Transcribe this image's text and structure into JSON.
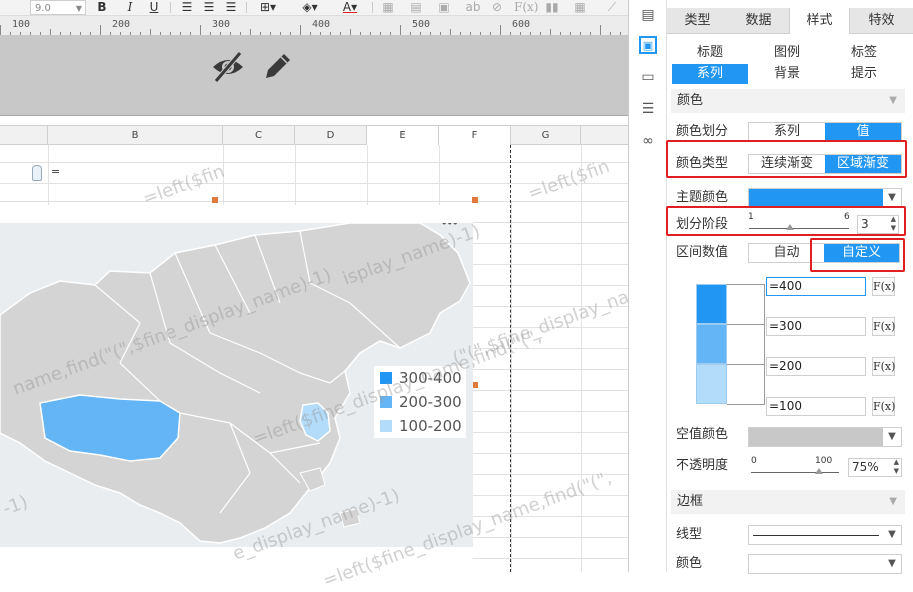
{
  "toolbar": {
    "font_size": "9.0",
    "bold": "B",
    "italic": "I",
    "underline": "U",
    "font_color": "A",
    "text_ab": "ab",
    "formula": "F(x)"
  },
  "ruler": {
    "labels": [
      "100",
      "200",
      "300",
      "400",
      "500",
      "600"
    ]
  },
  "sheet": {
    "columns": [
      "B",
      "C",
      "D",
      "E",
      "F",
      "G"
    ],
    "cell_formula": "=",
    "watermark_texts": [
      "=left($fin",
      "=left($fin",
      "isplay_name)-1)",
      "name,find(\"(\",$fine_display_name)-1)",
      "=left($fine_display_name,find(\"(\",",
      "e_display_name)-1)",
      "-1)",
      "(\"(\",$fine_display_name)-1)",
      "=left($fine_display_name,find(\"(\","
    ]
  },
  "map": {
    "legend": [
      {
        "label": "300-400",
        "color": "#2196f3"
      },
      {
        "label": "200-300",
        "color": "#64b5f6"
      },
      {
        "label": "100-200",
        "color": "#b3dcfb"
      }
    ],
    "more_icon": "•••"
  },
  "panel": {
    "main_tabs": [
      "类型",
      "数据",
      "样式",
      "特效"
    ],
    "active_main_tab": "样式",
    "sub_tabs": [
      "标题",
      "图例",
      "标签",
      "系列",
      "背景",
      "提示"
    ],
    "active_sub_tab": "系列",
    "color_section": "颜色",
    "color_division": {
      "label": "颜色划分",
      "options": [
        "系列",
        "值"
      ],
      "active": "值"
    },
    "color_type": {
      "label": "颜色类型",
      "options": [
        "连续渐变",
        "区域渐变"
      ],
      "active": "区域渐变"
    },
    "theme_color": {
      "label": "主题颜色",
      "value_color": "#2196f3"
    },
    "stages": {
      "label": "划分阶段",
      "min": "1",
      "max": "6",
      "value": "3"
    },
    "interval_values": {
      "label": "区间数值",
      "options": [
        "自动",
        "自定义"
      ],
      "active": "自定义"
    },
    "intervals": [
      {
        "value": "=400",
        "fx": "F(x)",
        "color": "#2196f3"
      },
      {
        "value": "=300",
        "fx": "F(x)",
        "color": "#64b5f6"
      },
      {
        "value": "=200",
        "fx": "F(x)",
        "color": "#b3dcfb"
      },
      {
        "value": "=100",
        "fx": "F(x)"
      }
    ],
    "null_color": {
      "label": "空值颜色",
      "value_color": "#c8c8c8"
    },
    "opacity": {
      "label": "不透明度",
      "min": "0",
      "max": "100",
      "value": "75%"
    },
    "border_section": "边框",
    "line_type": {
      "label": "线型"
    },
    "border_color": {
      "label": "颜色"
    }
  },
  "colors": {
    "accent": "#2196f3",
    "highlight_box": "#e02020",
    "map_region": "#d4d4d4"
  }
}
